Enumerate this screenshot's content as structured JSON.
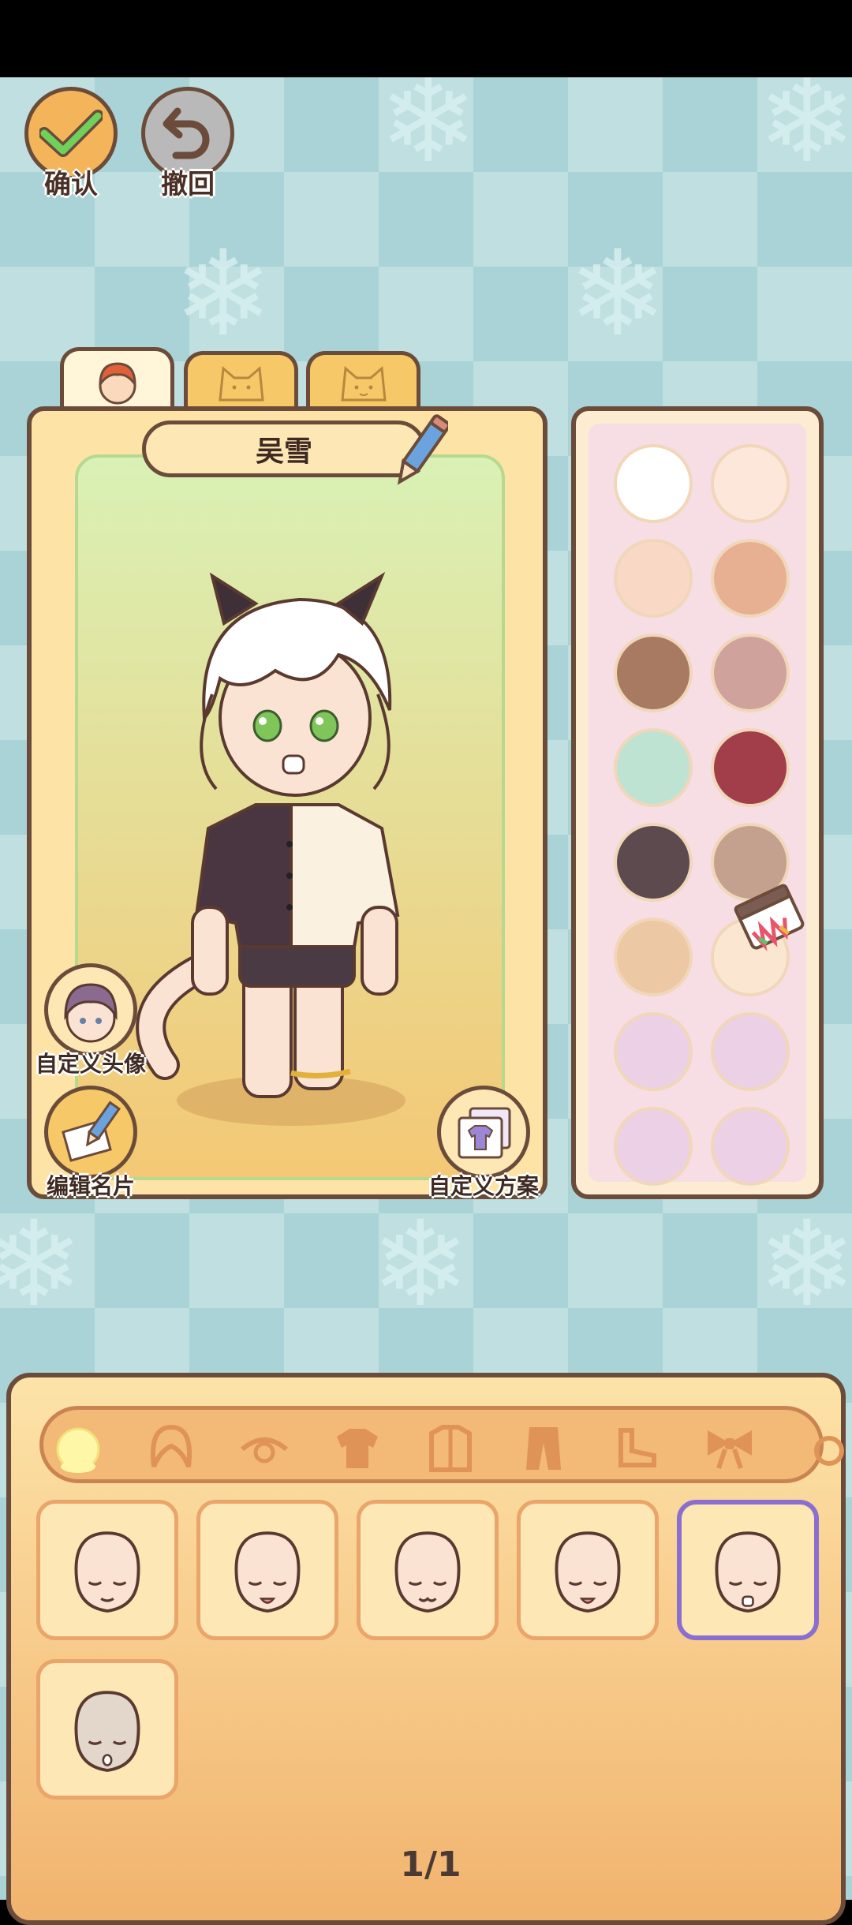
{
  "top_buttons": {
    "confirm_label": "确认",
    "undo_label": "撤回"
  },
  "tabs": [
    {
      "name": "avatar-tab",
      "icon": "boy-face-icon"
    },
    {
      "name": "cat-face-tab",
      "icon": "cat-face-icon"
    },
    {
      "name": "cat-face-alt-tab",
      "icon": "cat-face-icon"
    }
  ],
  "character": {
    "name": "吴雪"
  },
  "side_buttons": {
    "custom_avatar": "自定义头像",
    "edit_card": "编辑名片",
    "custom_plan": "自定义方案"
  },
  "skin_colors": [
    {
      "hex": "#ffffff",
      "selected": false
    },
    {
      "hex": "#fde7da",
      "selected": false
    },
    {
      "hex": "#f9d9c6",
      "selected": false
    },
    {
      "hex": "#e8b092",
      "selected": false
    },
    {
      "hex": "#a97a62",
      "selected": false
    },
    {
      "hex": "#cfa39c",
      "selected": false
    },
    {
      "hex": "#bfe3d3",
      "selected": false
    },
    {
      "hex": "#a13e4a",
      "selected": false
    },
    {
      "hex": "#5d4a4f",
      "selected": false
    },
    {
      "hex": "#c4a08e",
      "selected": false
    },
    {
      "hex": "#edc8a4",
      "selected": false
    },
    {
      "hex": "#fbe6d2",
      "selected": true
    },
    {
      "hex": "#ecd1e6",
      "selected": false
    },
    {
      "hex": "#ecd1e6",
      "selected": false
    },
    {
      "hex": "#ecd1e6",
      "selected": false
    },
    {
      "hex": "#ecd1e6",
      "selected": false
    }
  ],
  "categories": [
    {
      "name": "face-icon",
      "active": true
    },
    {
      "name": "hair-icon",
      "active": false
    },
    {
      "name": "eye-icon",
      "active": false
    },
    {
      "name": "shirt-icon",
      "active": false
    },
    {
      "name": "coat-icon",
      "active": false
    },
    {
      "name": "pants-icon",
      "active": false
    },
    {
      "name": "shoe-icon",
      "active": false
    },
    {
      "name": "bow-icon",
      "active": false
    },
    {
      "name": "accessory-icon",
      "active": false
    }
  ],
  "face_items": [
    {
      "expression": "closed-smile",
      "selected": false
    },
    {
      "expression": "closed-tongue",
      "selected": false
    },
    {
      "expression": "closed-cat-mouth",
      "selected": false
    },
    {
      "expression": "closed-tongue",
      "selected": false
    },
    {
      "expression": "sad-open",
      "selected": true
    },
    {
      "expression": "sleepy-open",
      "selected": false
    }
  ],
  "pager": {
    "text": "1/1"
  },
  "colors": {
    "border": "#6b4b3a",
    "accent_selected": "#8a6fcf",
    "tab": "#f6c867"
  }
}
